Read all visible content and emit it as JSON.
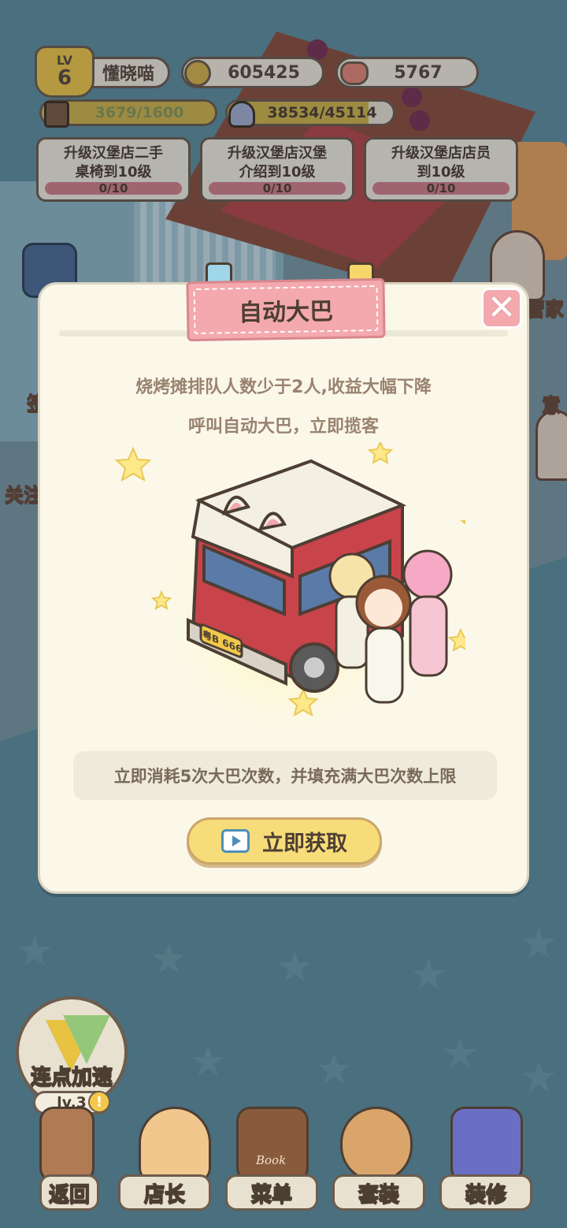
{
  "player": {
    "level_label": "LV",
    "level": "6",
    "name": "懂晓喵"
  },
  "currency": {
    "coins": "605425",
    "gems": "5767"
  },
  "progress": {
    "exp_text": "3679/1600",
    "exp_fill": 1.0,
    "decor_text": "38534/45114",
    "decor_fill": 0.85
  },
  "tasks": [
    {
      "title": "升级汉堡店二手\n桌椅到10级",
      "progress": "0/10"
    },
    {
      "title": "升级汉堡店汉堡\n介绍到10级",
      "progress": "0/10"
    },
    {
      "title": "升级汉堡店店员\n到10级",
      "progress": "0/10"
    }
  ],
  "side": {
    "right_1": "管家",
    "right_2": "意",
    "left_1": "关注",
    "left_2": "签"
  },
  "modal": {
    "title": "自动大巴",
    "description_1": "烧烤摊排队人数少于2人,收益大幅下降",
    "description_2": "呼叫自动大巴，立即揽客",
    "plate": "粤B 666",
    "info": "立即消耗5次大巴次数，并填充满大巴次数上限",
    "cta_label": "立即获取",
    "close_symbol": "✕"
  },
  "speedup": {
    "label": "连点加速",
    "level": "lv.3",
    "alert": "!"
  },
  "nav": {
    "back": "返回",
    "manager": "店长",
    "menu": "菜单",
    "outfit": "套装",
    "decorate": "装修",
    "book_text": "Book"
  },
  "colors": {
    "background": "#5f8fa0",
    "modal_bg": "#fbf8ea",
    "title_ribbon": "#f3a9ad",
    "cta": "#f7dc7a",
    "task_bar": "#d4828a"
  }
}
